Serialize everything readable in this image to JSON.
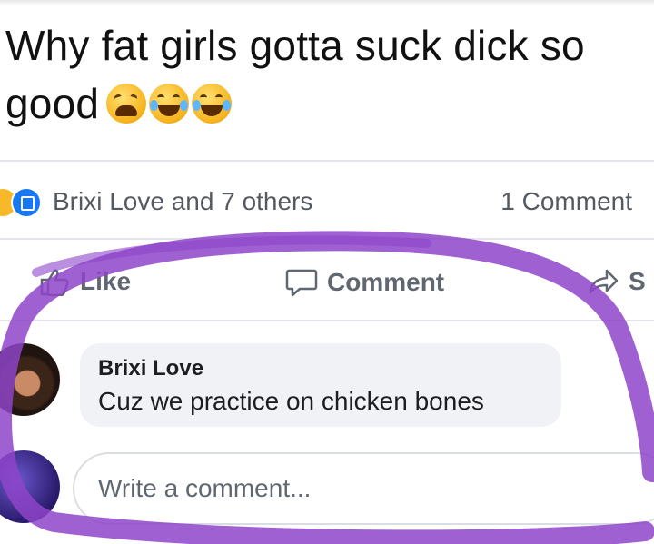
{
  "post": {
    "text_line1": "Why fat girls gotta suck dick so",
    "text_line2": "good",
    "emojis": [
      "weary-face-emoji",
      "tears-of-joy-emoji",
      "tears-of-joy-emoji"
    ]
  },
  "stats": {
    "reactions_text": "Brixi Love and 7 others",
    "comments_text": "1 Comment",
    "reaction_icons": [
      "haha-reaction-icon",
      "like-reaction-icon"
    ]
  },
  "actions": {
    "like_label": "Like",
    "comment_label": "Comment",
    "share_label": "S"
  },
  "comment": {
    "author": "Brixi Love",
    "text": "Cuz we practice on chicken bones"
  },
  "composer": {
    "placeholder": "Write a comment..."
  },
  "colors": {
    "highlight_ring": "#8e44c9",
    "facebook_blue": "#1877f2",
    "bubble_bg": "#f0f2f5",
    "secondary_text": "#606770"
  }
}
